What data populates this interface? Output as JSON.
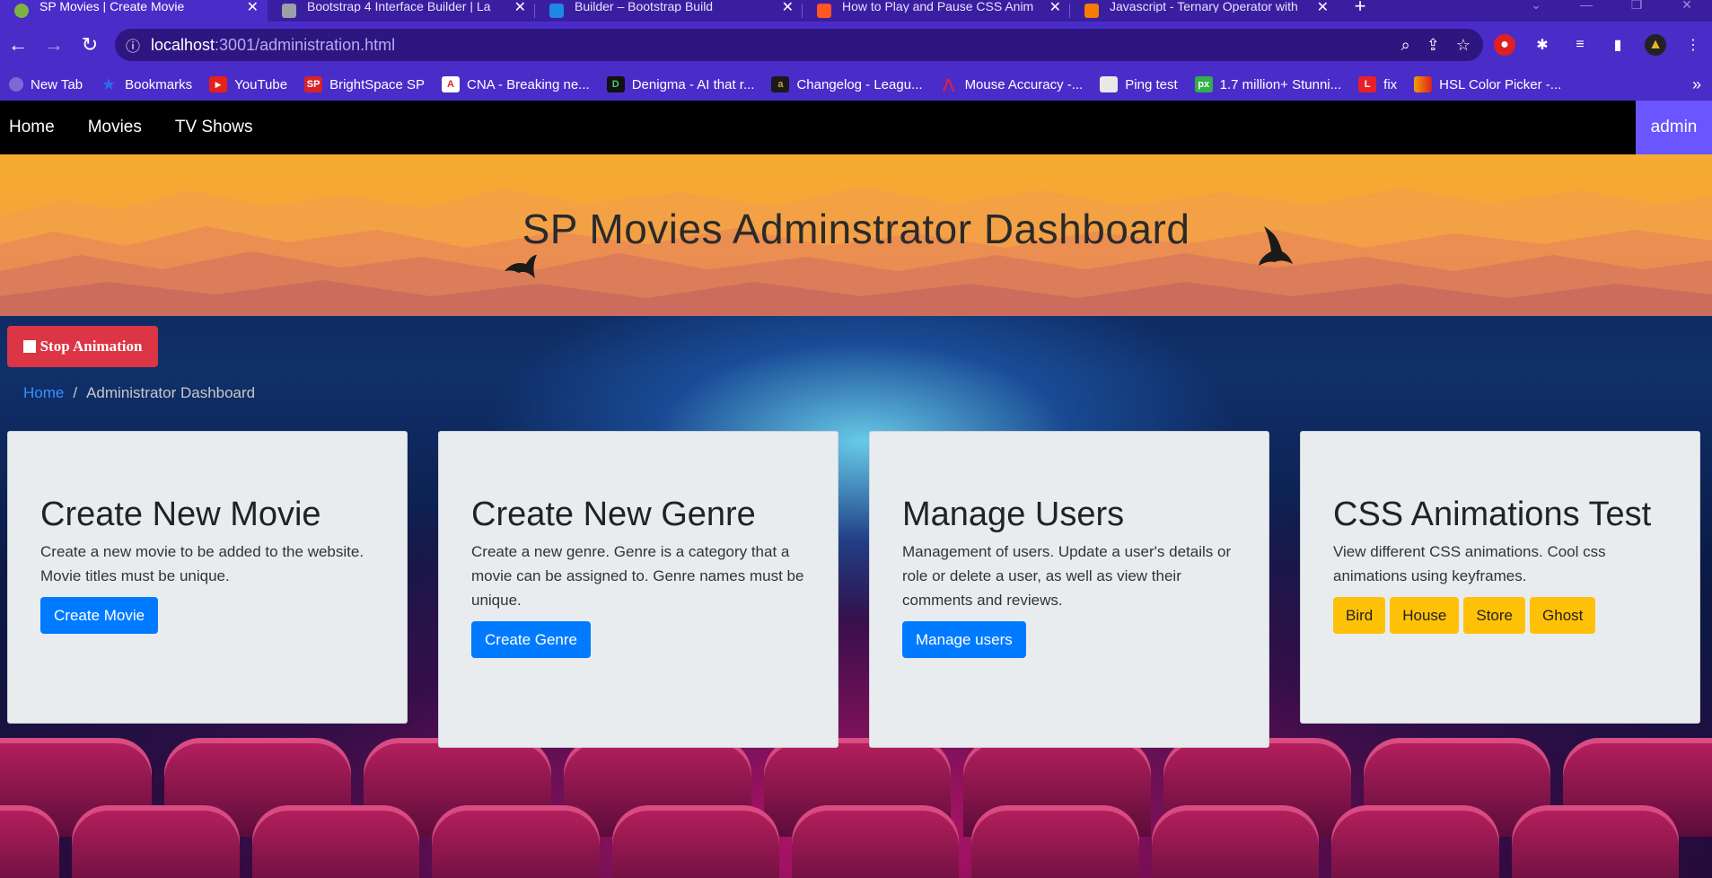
{
  "browser": {
    "tabs": [
      {
        "title": "SP Movies | Create Movie",
        "active": true,
        "favicon_color": "#7cb342"
      },
      {
        "title": "Bootstrap 4 Interface Builder | La",
        "active": false,
        "favicon_color": "#9aa0a6"
      },
      {
        "title": "Builder – Bootstrap Build",
        "active": false,
        "favicon_color": "#1e88e5"
      },
      {
        "title": "How to Play and Pause CSS Anim",
        "active": false,
        "favicon_color": "#ff5722"
      },
      {
        "title": "Javascript - Ternary Operator with",
        "active": false,
        "favicon_color": "#f57c00"
      }
    ],
    "new_tab_label": "+",
    "url_host": "localhost",
    "url_path": ":3001/administration.html",
    "bookmarks": [
      {
        "label": "New Tab",
        "color": "#7a6ad6",
        "glyph": ""
      },
      {
        "label": "Bookmarks",
        "color": "#2f6ae6",
        "glyph": "★"
      },
      {
        "label": "YouTube",
        "color": "#e62117",
        "glyph": "▶"
      },
      {
        "label": "BrightSpace SP",
        "color": "#d8232a",
        "glyph": "SP"
      },
      {
        "label": "CNA - Breaking ne...",
        "color": "#d8232a",
        "glyph": "A"
      },
      {
        "label": "Denigma - AI that r...",
        "color": "#111111",
        "glyph": "D"
      },
      {
        "label": "Changelog - Leagu...",
        "color": "#1a1a1a",
        "glyph": "a"
      },
      {
        "label": "Mouse Accuracy -...",
        "color": "#e0203a",
        "glyph": "⋀"
      },
      {
        "label": "Ping test",
        "color": "#e8e8e8",
        "glyph": ""
      },
      {
        "label": "1.7 million+ Stunni...",
        "color": "#2fb04a",
        "glyph": "px"
      },
      {
        "label": "fix",
        "color": "#e8202a",
        "glyph": "L"
      },
      {
        "label": "HSL Color Picker -...",
        "color": "#f0a000",
        "glyph": ""
      }
    ],
    "bookmarks_overflow": "»"
  },
  "nav": {
    "links": [
      "Home",
      "Movies",
      "TV Shows"
    ],
    "user": "admin"
  },
  "hero": {
    "title": "SP Movies Adminstrator Dashboard"
  },
  "animation_button": "Stop Animation",
  "breadcrumb": {
    "home": "Home",
    "separator": "/",
    "current": "Administrator Dashboard"
  },
  "cards": [
    {
      "title": "Create New Movie",
      "text": "Create a new movie to be added to the website. Movie titles must be unique.",
      "buttons": [
        "Create Movie"
      ]
    },
    {
      "title": "Create New Genre",
      "text": "Create a new genre. Genre is a category that a movie can be assigned to. Genre names must be unique.",
      "buttons": [
        "Create Genre"
      ]
    },
    {
      "title": "Manage Users",
      "text": "Management of users. Update a user's details or role or delete a user, as well as view their comments and reviews.",
      "buttons": [
        "Manage users"
      ]
    },
    {
      "title": "CSS Animations Test",
      "text": "View different CSS animations. Cool css animations using keyframes.",
      "buttons": [
        "Bird",
        "House",
        "Store",
        "Ghost"
      ]
    }
  ],
  "colors": {
    "primary": "#007bff",
    "danger": "#dc3545",
    "warning": "#ffc107",
    "admin_accent": "#6a55ff",
    "chrome": "#4a2cc9"
  }
}
